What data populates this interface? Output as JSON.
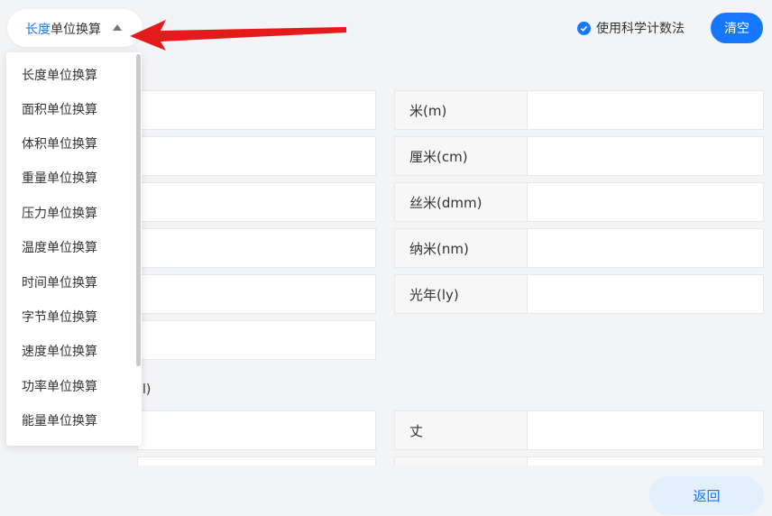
{
  "header": {
    "category_prefix": "长度",
    "category_suffix": "单位换算",
    "sci_notation_label": "使用科学计数法",
    "sci_notation_checked": true,
    "clear_label": "清空"
  },
  "dropdown": {
    "items": [
      "长度单位换算",
      "面积单位换算",
      "体积单位换算",
      "重量单位换算",
      "压力单位换算",
      "温度单位换算",
      "时间单位换算",
      "字节单位换算",
      "速度单位换算",
      "功率单位换算",
      "能量单位换算"
    ]
  },
  "units": [
    "米(m)",
    "厘米(cm)",
    "丝米(dmm)",
    "纳米(nm)",
    "光年(ly)"
  ],
  "section2": {
    "partial_label": "l)",
    "units": [
      "丈"
    ]
  },
  "footer": {
    "back_label": "返回"
  },
  "colors": {
    "accent": "#1677ff",
    "annotation": "#e41b1b"
  }
}
